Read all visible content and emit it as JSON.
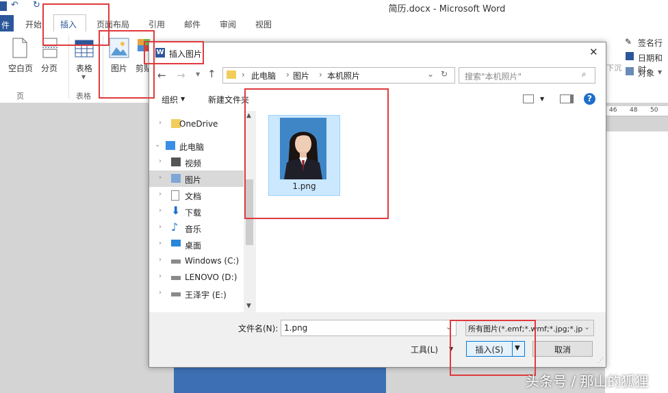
{
  "window": {
    "title": "简历.docx  -  Microsoft Word",
    "tabs": [
      "开始",
      "插入",
      "页面布局",
      "引用",
      "邮件",
      "审阅",
      "视图"
    ],
    "file_tab": "件"
  },
  "ribbon": {
    "blank_page": "空白页",
    "page_break": "分页",
    "group_pages": "页",
    "table": "表格",
    "group_tables": "表格",
    "picture": "图片",
    "clipart": "剪贴",
    "right_items": [
      "签名行",
      "日期和时",
      "对象"
    ],
    "wrap_label": "下沉"
  },
  "ruler": {
    "ticks": [
      "46",
      "48",
      "50"
    ]
  },
  "dialog": {
    "title": "插入图片",
    "close_glyph": "✕",
    "breadcrumb": [
      "此电脑",
      "图片",
      "本机照片"
    ],
    "search_placeholder": "搜索\"本机照片\"",
    "organize": "组织",
    "new_folder": "新建文件夹",
    "help_glyph": "?",
    "nav_items": [
      {
        "label": "OneDrive",
        "icon": "folder-icon"
      },
      {
        "label": "此电脑",
        "icon": "computer-icon"
      },
      {
        "label": "视频",
        "icon": "video-icon"
      },
      {
        "label": "图片",
        "icon": "pictures-icon"
      },
      {
        "label": "文档",
        "icon": "document-icon"
      },
      {
        "label": "下载",
        "icon": "download-icon"
      },
      {
        "label": "音乐",
        "icon": "music-icon"
      },
      {
        "label": "桌面",
        "icon": "desktop-icon"
      },
      {
        "label": "Windows (C:)",
        "icon": "drive-icon"
      },
      {
        "label": "LENOVO (D:)",
        "icon": "drive-icon"
      },
      {
        "label": "王泽宇 (E:)",
        "icon": "drive-icon"
      }
    ],
    "file": {
      "name": "1.png"
    },
    "filename_label": "文件名(N):",
    "filename_value": "1.png",
    "filetype_value": "所有图片(*.emf;*.wmf;*.jpg;*.jp",
    "tools": "工具(L)",
    "insert": "插入(S)",
    "cancel": "取消"
  },
  "watermark": "头条号 / 那山的狐狸",
  "colors": {
    "accent": "#2b579a",
    "highlight": "#e0393c",
    "selection": "#cce8ff"
  }
}
